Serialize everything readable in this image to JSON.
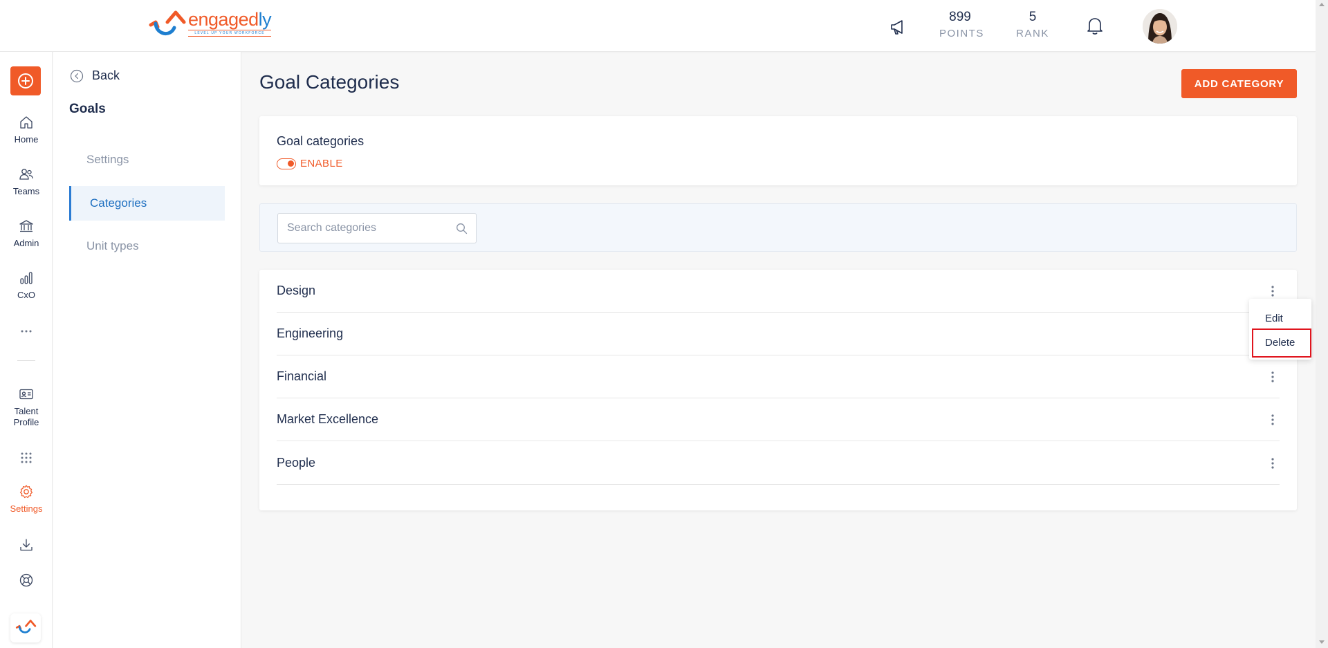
{
  "header": {
    "brand_name": "engagedly",
    "brand_tagline": "LEVEL UP YOUR WORKFORCE",
    "points_value": "899",
    "points_label": "POINTS",
    "rank_value": "5",
    "rank_label": "RANK",
    "icons": [
      "megaphone-icon",
      "bell-icon"
    ]
  },
  "rail": {
    "items": [
      {
        "label": "Home",
        "icon": "home-icon"
      },
      {
        "label": "Teams",
        "icon": "teams-icon"
      },
      {
        "label": "Admin",
        "icon": "admin-icon"
      },
      {
        "label": "CxO",
        "icon": "chart-icon"
      },
      {
        "label": "Talent Profile",
        "icon": "id-card-icon"
      },
      {
        "label": "Settings",
        "icon": "gear-icon"
      }
    ]
  },
  "sidebar": {
    "back_label": "Back",
    "title": "Goals",
    "items": [
      {
        "label": "Settings"
      },
      {
        "label": "Categories"
      },
      {
        "label": "Unit types"
      }
    ]
  },
  "main": {
    "title": "Goal Categories",
    "add_button": "ADD CATEGORY",
    "toggle_card_title": "Goal categories",
    "toggle_label": "ENABLE",
    "search_placeholder": "Search categories",
    "categories": [
      "Design",
      "Engineering",
      "Financial",
      "Market Excellence",
      "People"
    ]
  },
  "context_menu": {
    "edit": "Edit",
    "delete": "Delete"
  },
  "colors": {
    "accent": "#f05a28",
    "brand_blue": "#1e7fd0",
    "highlight_red": "#e0151e"
  }
}
